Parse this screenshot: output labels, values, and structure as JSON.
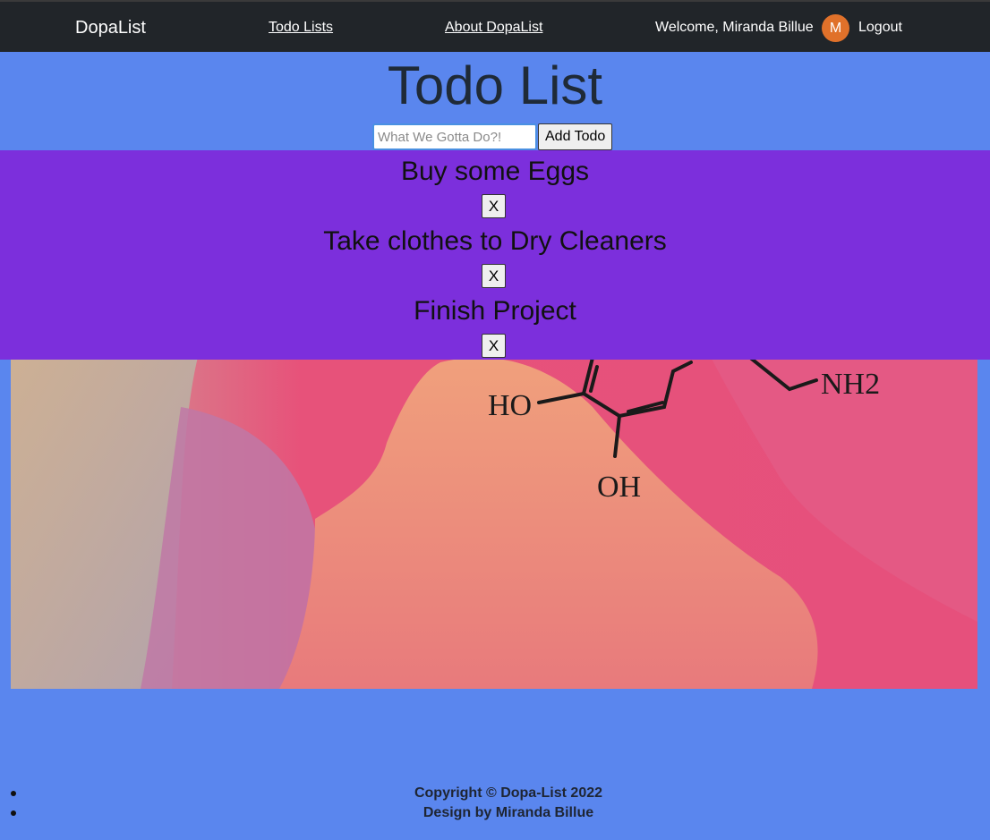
{
  "nav": {
    "brand": "DopaList",
    "links": [
      "Todo Lists",
      "About DopaList"
    ],
    "welcome": "Welcome, Miranda Billue",
    "avatar_initial": "M",
    "logout": "Logout"
  },
  "page": {
    "title": "Todo List"
  },
  "form": {
    "placeholder": "What We Gotta Do?!",
    "add_button": "Add Todo"
  },
  "todos": [
    {
      "text": "Buy some Eggs",
      "delete_label": "X"
    },
    {
      "text": "Take clothes to Dry Cleaners",
      "delete_label": "X"
    },
    {
      "text": "Finish Project",
      "delete_label": "X"
    }
  ],
  "hero": {
    "formula_labels": [
      "HO",
      "OH",
      "NH2"
    ]
  },
  "footer": [
    "Copyright © Dopa-List 2022",
    "Design by Miranda Billue"
  ],
  "colors": {
    "background": "#5a86ee",
    "navbar": "#212529",
    "todo_panel": "#7c2fdc",
    "avatar": "#e0712a"
  }
}
